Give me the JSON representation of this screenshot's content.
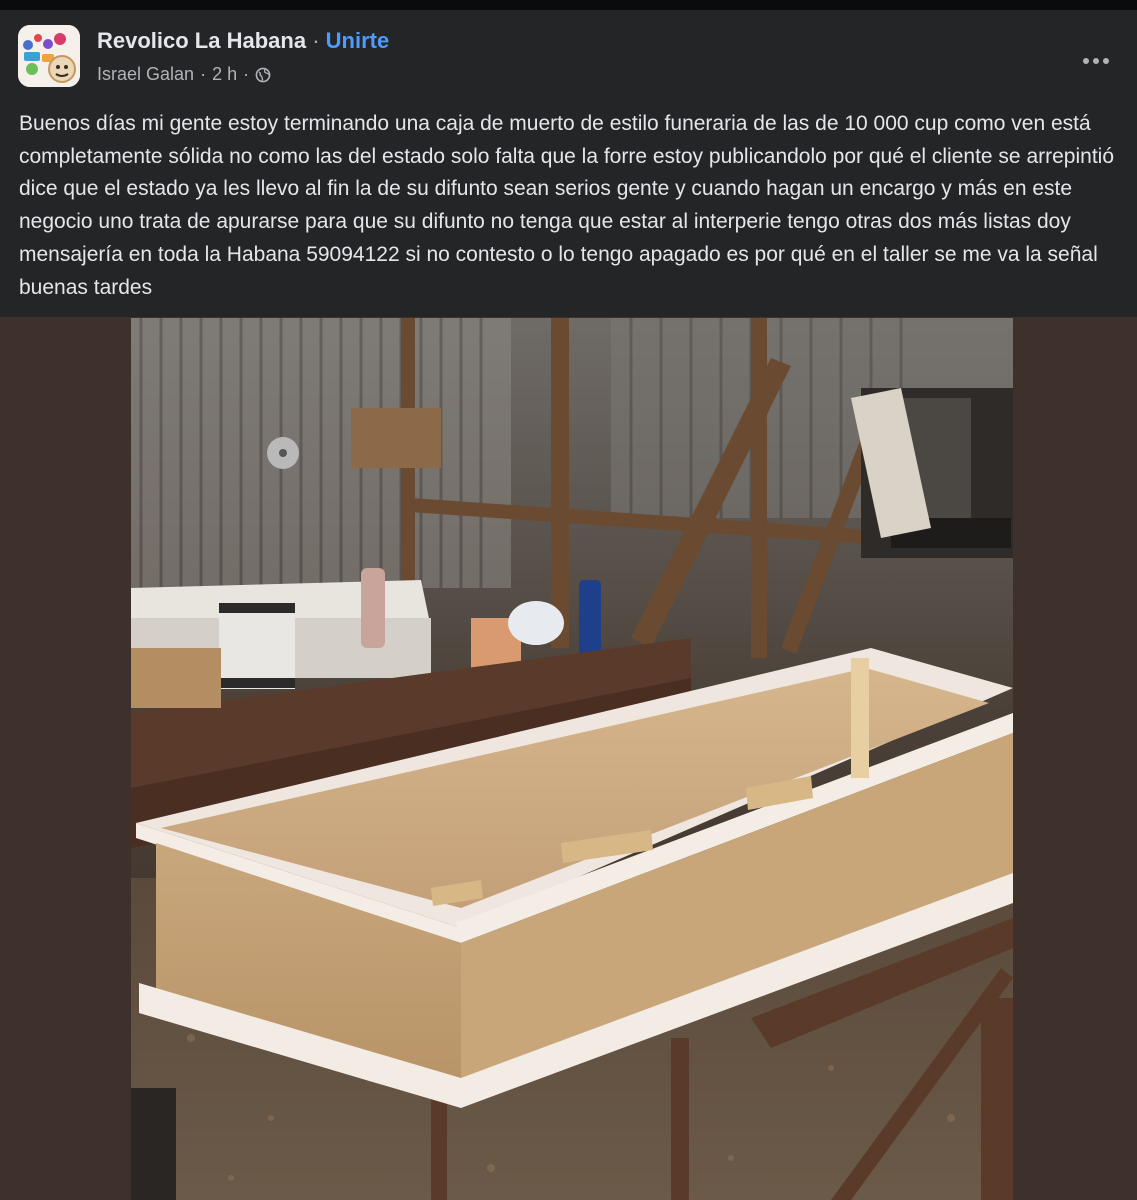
{
  "post": {
    "group_name": "Revolico La Habana",
    "separator": "·",
    "join_label": "Unirte",
    "author": "Israel Galan",
    "meta_separator": "·",
    "time_ago": "2 h",
    "audience_icon": "globe-icon",
    "more_icon": "more-options-icon",
    "text": "Buenos días mi gente estoy terminando una caja de muerto de estilo funeraria de las de 10 000 cup como ven está completamente sólida no como las del estado solo falta que la forre estoy publicandolo por qué el cliente se arrepintió dice que el estado ya les llevo al fin la de su difunto sean serios gente y cuando hagan un encargo y más en este negocio uno trata de apurarse para que su difunto no tenga que estar al interperie tengo otras dos más listas doy mensajería en toda la Habana 59094122 si no contesto o lo tengo apagado es por qué en el taller se me va la señal buenas tardes"
  },
  "photo": {
    "subject": "coffin-in-workshop"
  },
  "colors": {
    "card_background": "#242526",
    "page_background": "#3e312c",
    "primary_text": "#e4e6eb",
    "secondary_text": "#b0b3b8",
    "link_blue": "#4e9bff"
  }
}
